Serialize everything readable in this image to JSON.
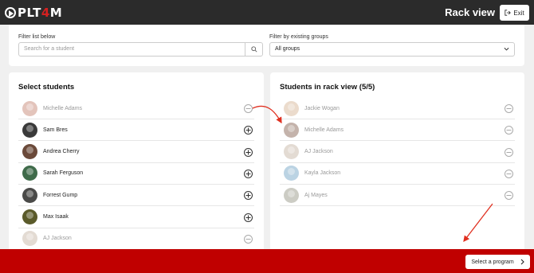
{
  "header": {
    "logo_text_main": "PLT",
    "logo_text_accent": "4",
    "logo_text_end": "M",
    "title": "Rack view",
    "exit_label": "Exit"
  },
  "filters": {
    "search_label": "Filter list below",
    "search_placeholder": "Search for a student",
    "group_label": "Filter by existing groups",
    "group_value": "All groups"
  },
  "select_panel": {
    "title": "Select students",
    "students": [
      {
        "name": "Michelle Adams",
        "state": "selected",
        "color": "#c98a7a"
      },
      {
        "name": "Sam Bres",
        "state": "available",
        "color": "#3a3a3a"
      },
      {
        "name": "Andrea Cherry",
        "state": "available",
        "color": "#6b4a3a"
      },
      {
        "name": "Sarah Ferguson",
        "state": "available",
        "color": "#3f6b4a"
      },
      {
        "name": "Forrest Gump",
        "state": "available",
        "color": "#4a4a48"
      },
      {
        "name": "Max Isaak",
        "state": "available",
        "color": "#5a5a2a"
      },
      {
        "name": "AJ Jackson",
        "state": "selected",
        "color": "#c9b8a8"
      }
    ]
  },
  "rack_panel": {
    "title": "Students in rack view (5/5)",
    "students": [
      {
        "name": "Jackie Wogan",
        "color": "#d8b89a"
      },
      {
        "name": "Michelle Adams",
        "color": "#8a6a5a"
      },
      {
        "name": "AJ Jackson",
        "color": "#c9b8a8"
      },
      {
        "name": "Kayla Jackson",
        "color": "#7aa8c8"
      },
      {
        "name": "Aj Mayes",
        "color": "#9a9a8a"
      }
    ]
  },
  "footer": {
    "program_label": "Select a program"
  },
  "colors": {
    "topbar": "#2b2b2b",
    "bottombar": "#c00000",
    "annotation_arrow": "#e03020"
  },
  "icons": {
    "add": "plus-circle-icon",
    "remove": "minus-circle-icon"
  }
}
